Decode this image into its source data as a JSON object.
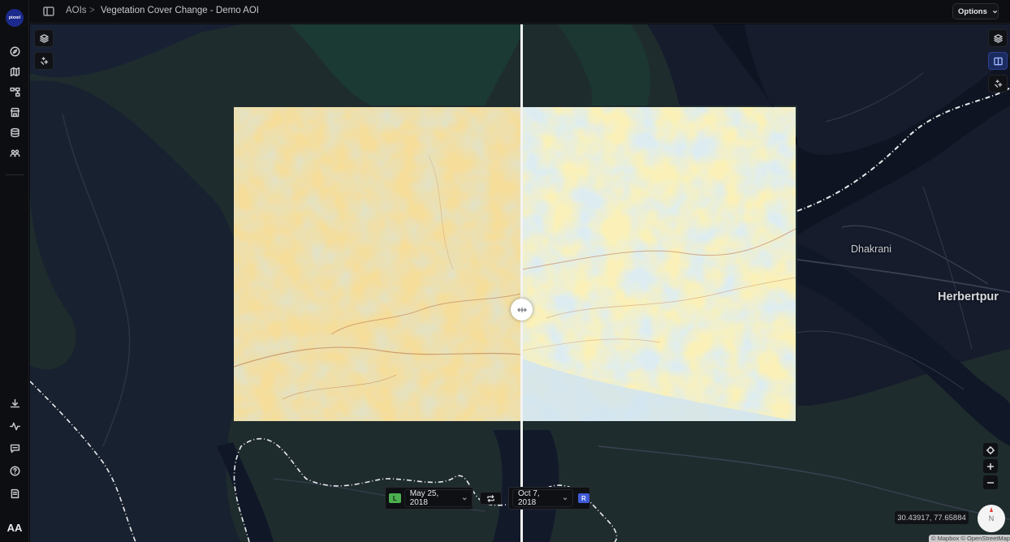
{
  "app": {
    "logo_text": "pixxel",
    "avatar_initials": "AA"
  },
  "breadcrumb": {
    "root": "AOIs",
    "separator": ">",
    "current": "Vegetation Cover Change - Demo AOI"
  },
  "toolbar": {
    "options_label": "Options"
  },
  "sidebar": {
    "top_icons": [
      "compass-icon",
      "map-icon",
      "workflow-icon",
      "store-icon",
      "database-icon",
      "team-icon"
    ],
    "bottom_icons": [
      "download-icon",
      "activity-icon",
      "feedback-icon",
      "help-icon",
      "docs-icon"
    ]
  },
  "map": {
    "places": {
      "dhakrani": "Dhakrani",
      "herbertpur": "Herbertpur"
    },
    "coordinates": "30.43917, 77.65884",
    "compass_label": "N",
    "attribution": "© Mapbox © OpenStreetMap",
    "colors": {
      "water": "#161b2b",
      "land": "#1f2c2e",
      "road": "#3b4150",
      "boundary": "#e9eaec"
    }
  },
  "compare": {
    "left_tag": "L",
    "left_date": "May 25, 2018",
    "right_tag": "R",
    "right_date": "Oct 7, 2018",
    "left_color": "#4caf50",
    "right_color": "#3f5ad6"
  }
}
